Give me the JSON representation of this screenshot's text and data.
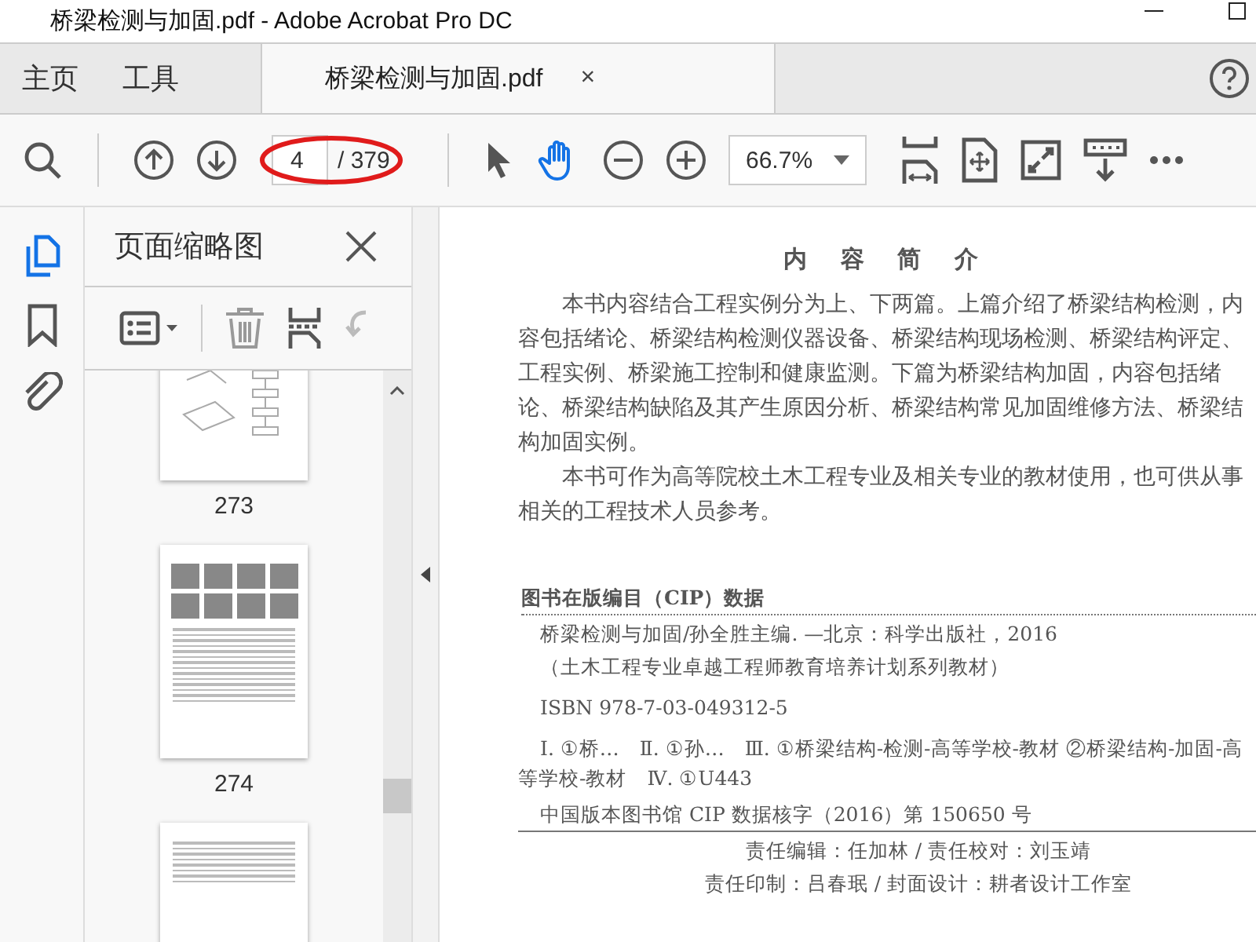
{
  "window": {
    "title": "桥梁检测与加固.pdf - Adobe Acrobat Pro DC"
  },
  "tabs": [
    {
      "label": "主页",
      "selected": false
    },
    {
      "label": "工具",
      "selected": false
    },
    {
      "label": "桥梁检测与加固.pdf",
      "selected": true,
      "close_label": "×"
    }
  ],
  "toolbar": {
    "page_number": "4",
    "page_total": "/ 379",
    "page_field_circled": true,
    "zoom": "66.7%"
  },
  "side_rail": [
    {
      "kind": "thumbnails",
      "selected": true
    },
    {
      "kind": "bookmarks",
      "selected": false
    },
    {
      "kind": "attachments",
      "selected": false
    }
  ],
  "panel": {
    "title": "页面缩略图",
    "thumbnails": [
      {
        "kind": "diagram",
        "label": "273"
      },
      {
        "kind": "photos",
        "label": "274"
      },
      {
        "kind": "text"
      }
    ]
  },
  "document": {
    "heading": "内 容 简 介",
    "paragraphs": [
      "本书内容结合工程实例分为上、下两篇。上篇介绍了桥梁结构检测，内容包括绪论、桥梁结构检测仪器设备、桥梁结构现场检测、桥梁结构评定、工程实例、桥梁施工控制和健康监测。下篇为桥梁结构加固，内容包括绪论、桥梁结构缺陷及其产生原因分析、桥梁结构常见加固维修方法、桥梁结构加固实例。",
      "本书可作为高等院校土木工程专业及相关专业的教材使用，也可供从事相关的工程技术人员参考。"
    ],
    "cip_title": "图书在版编目（CIP）数据",
    "cip_lines": [
      "桥梁检测与加固/孙全胜主编. —北京：科学出版社，2016",
      "（土木工程专业卓越工程师教育培养计划系列教材）",
      "ISBN 978-7-03-049312-5",
      "Ⅰ. ①桥…　Ⅱ. ①孙…　Ⅲ. ①桥梁结构-检测-高等学校-教材 ②桥梁结构-加固-高等学校-教材　Ⅳ. ①U443"
    ],
    "cip_number": "中国版本图书馆 CIP 数据核字（2016）第 150650 号",
    "credits": [
      "责任编辑：任加林 / 责任校对：刘玉靖",
      "责任印制：吕春珉 / 封面设计：耕者设计工作室"
    ]
  }
}
